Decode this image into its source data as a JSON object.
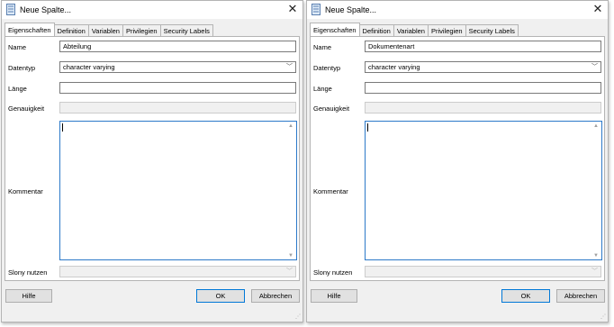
{
  "dialogs": [
    {
      "title": "Neue Spalte...",
      "tabs": [
        "Eigenschaften",
        "Definition",
        "Variablen",
        "Privilegien",
        "Security Labels"
      ],
      "labels": {
        "name": "Name",
        "datatype": "Datentyp",
        "length": "Länge",
        "precision": "Genauigkeit",
        "comment": "Kommentar",
        "slony": "Slony nutzen"
      },
      "values": {
        "name": "Abteilung",
        "datatype": "character varying",
        "length": "",
        "precision": "",
        "comment": ""
      },
      "buttons": {
        "help": "Hilfe",
        "ok": "OK",
        "cancel": "Abbrechen"
      }
    },
    {
      "title": "Neue Spalte...",
      "tabs": [
        "Eigenschaften",
        "Definition",
        "Variablen",
        "Privilegien",
        "Security Labels"
      ],
      "labels": {
        "name": "Name",
        "datatype": "Datentyp",
        "length": "Länge",
        "precision": "Genauigkeit",
        "comment": "Kommentar",
        "slony": "Slony nutzen"
      },
      "values": {
        "name": "Dokumentenart",
        "datatype": "character varying",
        "length": "",
        "precision": "",
        "comment": ""
      },
      "buttons": {
        "help": "Hilfe",
        "ok": "OK",
        "cancel": "Abbrechen"
      }
    }
  ],
  "icons": {
    "title": "column-icon",
    "close": "close-icon",
    "dropdown": "chevron-down-icon",
    "resize": "resize-grip-icon"
  },
  "colors": {
    "window_bg": "#f0f0f0",
    "focus_border": "#2c79c9",
    "default_button_border": "#0078d7"
  }
}
